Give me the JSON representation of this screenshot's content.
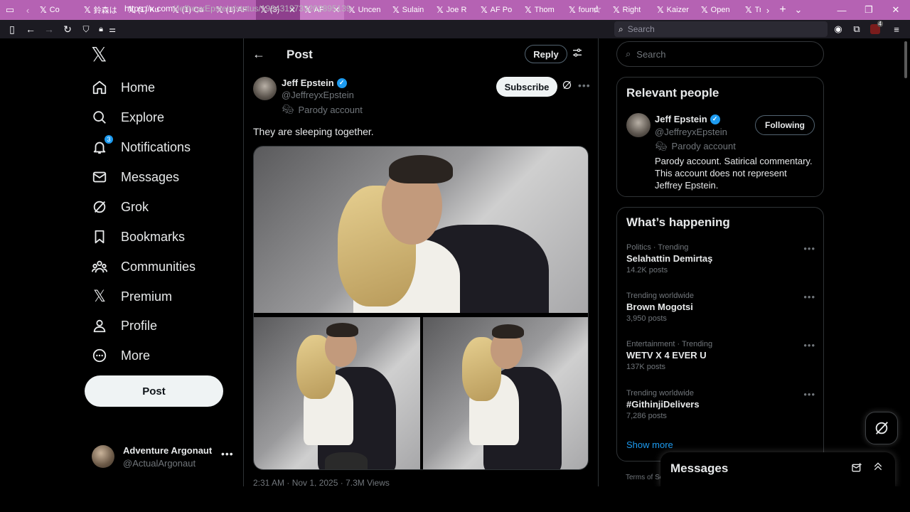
{
  "browser": {
    "tabs": [
      {
        "label": "Co"
      },
      {
        "label": "鈴森は"
      },
      {
        "label": "(1) Ku"
      },
      {
        "label": "(1) Ca"
      },
      {
        "label": "(1) AF"
      },
      {
        "label": "(3)"
      },
      {
        "label": "AF"
      },
      {
        "label": "Uncen"
      },
      {
        "label": "Sulain"
      },
      {
        "label": "Joe R"
      },
      {
        "label": "AF Po"
      },
      {
        "label": "Thom"
      },
      {
        "label": "found"
      },
      {
        "label": "Right"
      },
      {
        "label": "Kaizer"
      },
      {
        "label": "Open"
      },
      {
        "label": "Tr"
      }
    ],
    "url_domain": "https://x.com",
    "url_path": "/JeffreyxEpstein/status/1984319733202895139",
    "search_placeholder": "Search",
    "extension_badge": "4"
  },
  "nav": {
    "items": [
      {
        "label": "Home",
        "icon": "home-icon"
      },
      {
        "label": "Explore",
        "icon": "search-icon"
      },
      {
        "label": "Notifications",
        "icon": "bell-icon",
        "badge": "3"
      },
      {
        "label": "Messages",
        "icon": "envelope-icon"
      },
      {
        "label": "Grok",
        "icon": "grok-icon"
      },
      {
        "label": "Bookmarks",
        "icon": "bookmark-icon"
      },
      {
        "label": "Communities",
        "icon": "communities-icon"
      },
      {
        "label": "Premium",
        "icon": "x-logo-icon"
      },
      {
        "label": "Profile",
        "icon": "person-icon"
      },
      {
        "label": "More",
        "icon": "more-circle-icon"
      }
    ],
    "post_label": "Post",
    "account": {
      "name": "Adventure Argonaut",
      "handle": "@ActualArgonaut"
    }
  },
  "main": {
    "title": "Post",
    "reply_label": "Reply",
    "post": {
      "author": "Jeff Epstein",
      "handle": "@JeffreyxEpstein",
      "parody_label": "Parody account",
      "subscribe_label": "Subscribe",
      "text": "They are sleeping together.",
      "timestamp": "2:31 AM · Nov 1, 2025 · 7.3M Views"
    }
  },
  "right": {
    "search_placeholder": "Search",
    "relevant": {
      "title": "Relevant people",
      "name": "Jeff Epstein",
      "handle": "@JeffreyxEpstein",
      "parody_label": "Parody account",
      "bio": "Parody account. Satirical commentary. This account does not represent Jeffrey Epstein.",
      "follow_label": "Following"
    },
    "happening": {
      "title": "What’s happening",
      "trends": [
        {
          "category": "Politics · Trending",
          "title": "Selahattin Demirtaş",
          "count": "14.2K posts"
        },
        {
          "category": "Trending worldwide",
          "title": "Brown Mogotsi",
          "count": "3,950 posts"
        },
        {
          "category": "Entertainment · Trending",
          "title": "WETV X 4 EVER U",
          "count": "137K posts"
        },
        {
          "category": "Trending worldwide",
          "title": "#GithinjiDelivers",
          "count": "7,286 posts"
        }
      ],
      "show_more": "Show more"
    },
    "terms": "Terms of Se"
  },
  "drawer": {
    "title": "Messages"
  }
}
